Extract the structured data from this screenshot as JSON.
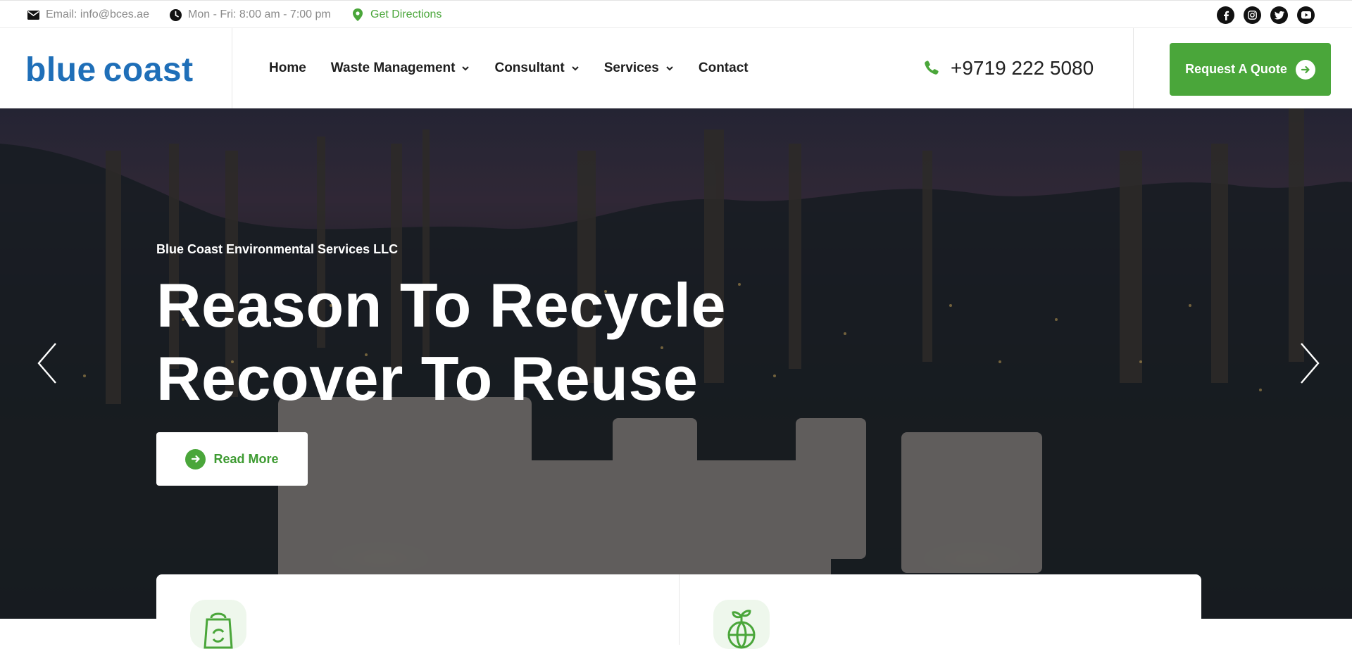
{
  "topbar": {
    "email": "Email: info@bces.ae",
    "hours": "Mon - Fri: 8:00 am - 7:00 pm",
    "directions": "Get Directions",
    "social": [
      "facebook-icon",
      "instagram-icon",
      "twitter-icon",
      "youtube-icon"
    ]
  },
  "header": {
    "logo": {
      "part1": "blue",
      "part2": "coast"
    },
    "nav": [
      {
        "label": "Home",
        "dropdown": false
      },
      {
        "label": "Waste Management",
        "dropdown": true
      },
      {
        "label": "Consultant",
        "dropdown": true
      },
      {
        "label": "Services",
        "dropdown": true
      },
      {
        "label": "Contact",
        "dropdown": false
      }
    ],
    "phone": "+9719 222 5080",
    "quote_label": "Request A Quote"
  },
  "hero": {
    "subtitle": "Blue Coast Environmental Services LLC",
    "title_line1": "Reason To Recycle",
    "title_line2": "Recover To Reuse",
    "read_more": "Read More"
  },
  "colors": {
    "accent_green": "#4aa63a",
    "brand_blue": "#1f6fb8",
    "nav_text": "#1e1e1e",
    "muted_text": "#8a8a8a"
  }
}
